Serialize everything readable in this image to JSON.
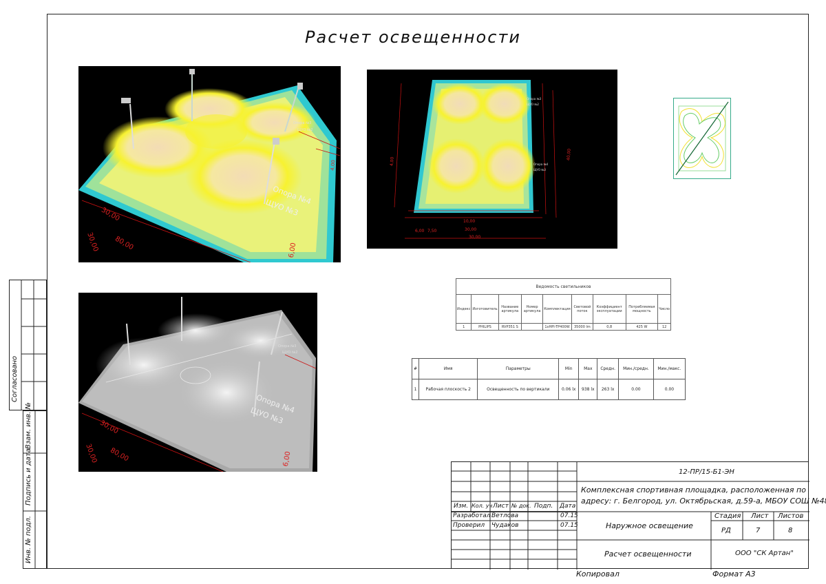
{
  "title": "Расчет освещенности",
  "render1": {
    "labels": [
      "Опора №4",
      "ЩУО №3"
    ],
    "dims": [
      "30,00",
      "80,00",
      "30,00",
      "6,00",
      "4,00"
    ],
    "small": [
      "Опора №3",
      "ЩУО №2"
    ]
  },
  "render2": {
    "dims": [
      "10,00",
      "30,00",
      "40,00",
      "4,00",
      "6,00",
      "7,50",
      "30,00"
    ],
    "small": [
      "Опора №3",
      "ЩУО №2",
      "Опора №4",
      "ЩУО №3"
    ]
  },
  "render3": {
    "labels": [
      "Опора №4",
      "ЩУО №3"
    ],
    "dims": [
      "30,00",
      "80,00",
      "30,00",
      "6,00"
    ],
    "small": [
      "Опора №3",
      "ЩУО №2"
    ]
  },
  "luminaires": {
    "caption": "Ведомость светильников",
    "headers": [
      "Индекс",
      "Изготовитель",
      "Название артикула",
      "Номер артикула",
      "Комплектация",
      "Световой поток",
      "Коэффициент эксплуатации",
      "Потребляемая мощность",
      "Число"
    ],
    "rows": [
      [
        "1",
        "PHILIPS",
        "RVP351 S",
        "",
        "1xHPI-TP400W",
        "35000 lm",
        "0,8",
        "425 W",
        "12"
      ]
    ]
  },
  "calc": {
    "headers": [
      "#",
      "Имя",
      "Параметры",
      "Min",
      "Max",
      "Средн.",
      "Мин./средн.",
      "Мин./макс."
    ],
    "rows": [
      [
        "1",
        "Рабочая плоскость 2",
        "Освещенность по вертикали",
        "0.06 lx",
        "938 lx",
        "263 lx",
        "0.00",
        "0.00"
      ]
    ]
  },
  "stamp": {
    "agreed": "Согласовано",
    "replace": "Взам. инв. №",
    "sign_date": "Подпись и дата",
    "inv": "Инв. № подл."
  },
  "titleblock": {
    "code": "12-ПР/15-Б1-ЭН",
    "object": "Комплексная спортивная площадка, расположенная по адресу: г. Белгород, ул. Октябрьская, д.59-а, МБОУ СОШ №48",
    "object_l1": "Комплексная спортивная площадка, расположенная по",
    "object_l2": "адресу: г. Белгород, ул. Октябрьская, д.59-а, МБОУ СОШ №48",
    "cols": [
      "Изм.",
      "Кол. уч",
      "Лист",
      "№ док.",
      "Подп.",
      "Дата"
    ],
    "row1": [
      "Разработал",
      "Ветлова",
      "07.15"
    ],
    "row2": [
      "Проверил",
      "Чудаков",
      "07.15"
    ],
    "section": "Наружное освещение",
    "stage_h": "Стадия",
    "sheet_h": "Лист",
    "sheets_h": "Листов",
    "stage": "РД",
    "sheet": "7",
    "sheets": "8",
    "sheet_title": "Расчет освещенности",
    "company": "ООО \"СК Артан\""
  },
  "footer": {
    "copied": "Копировал",
    "format": "Формат А3"
  }
}
